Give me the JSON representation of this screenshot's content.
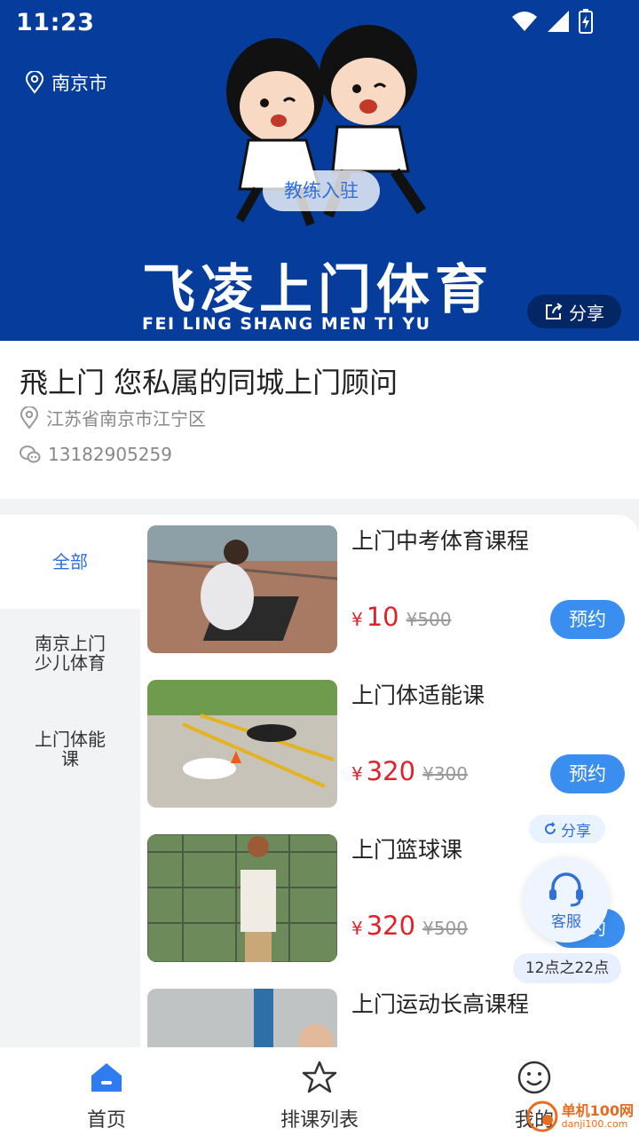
{
  "status_bar": {
    "time": "11:23"
  },
  "banner": {
    "location": "南京市",
    "coach_button": "教练入驻",
    "brand_cn": "飞凌上门体育",
    "brand_en": "FEI LING SHANG MEN TI YU",
    "share_label": "分享"
  },
  "info": {
    "title": "飛上门 您私属的同城上门顾问",
    "address": "江苏省南京市江宁区",
    "phone": "13182905259"
  },
  "sidebar": {
    "items": [
      {
        "label": "全部",
        "active": true
      },
      {
        "label": "南京上门少儿体育",
        "active": false
      },
      {
        "label": "上门体能课",
        "active": false
      }
    ]
  },
  "courses": [
    {
      "name": "上门中考体育课程",
      "currency": "¥",
      "price": "10",
      "old_price": "¥500",
      "button": "预约"
    },
    {
      "name": "上门体适能课",
      "currency": "¥",
      "price": "320",
      "old_price": "¥300",
      "button": "预约"
    },
    {
      "name": "上门篮球课",
      "currency": "¥",
      "price": "320",
      "old_price": "¥500",
      "button": "预约"
    },
    {
      "name": "上门运动长高课程"
    }
  ],
  "floating": {
    "share": "分享",
    "service": "客服",
    "hours": "12点之22点"
  },
  "bottom_nav": {
    "items": [
      {
        "label": "首页",
        "icon": "home-icon",
        "active": true
      },
      {
        "label": "排课列表",
        "icon": "star-icon",
        "active": false
      },
      {
        "label": "我的",
        "icon": "smiley-icon",
        "active": false
      }
    ]
  },
  "watermark": {
    "text": "单机100网",
    "sub": "danji100.com"
  },
  "colors": {
    "banner": "#063d9c",
    "accent": "#3a8ef0",
    "price": "#e0222b"
  }
}
